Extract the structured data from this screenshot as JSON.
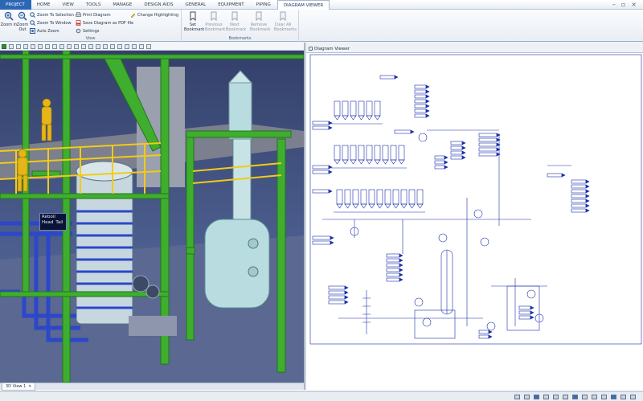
{
  "ribbon": {
    "tabs": [
      "PROJECT",
      "HOME",
      "VIEW",
      "TOOLS",
      "MANAGE",
      "DESIGN AIDS",
      "GENERAL",
      "EQUIPMENT",
      "PIPING",
      "DIAGRAM VIEWER"
    ],
    "active_tab": "DIAGRAM VIEWER",
    "view_group": {
      "zoom_in_label": "Zoom In",
      "zoom_out_label": "Zoom Out",
      "zoom_to_selection": "Zoom To Selection",
      "zoom_to_window": "Zoom To Window",
      "auto_zoom": "Auto Zoom",
      "print_diagram": "Print Diagram",
      "save_as_pdf": "Save Diagram as PDF file",
      "settings": "Settings",
      "change_highlighting": "Change Highlighting",
      "label": "View"
    },
    "bookmarks_group": {
      "set_bookmark": "Set Bookmark",
      "previous_bookmark": "Previous Bookmark",
      "next_bookmark": "Next Bookmark",
      "remove_bookmark": "Remove Bookmark",
      "clear_all_bookmarks": "Clear All Bookmarks",
      "label": "Bookmarks"
    }
  },
  "model_view": {
    "tag_label_1": "Reboil",
    "tag_label_2": "Head",
    "tag_label_3": "Tail",
    "tab_label": "3D View 1"
  },
  "diagram_viewer": {
    "title": "Diagram Viewer"
  },
  "colors": {
    "steel_green": "#3fae2f",
    "handrail_yellow": "#f2cb16",
    "pipe_blue": "#2c47c9",
    "vessel_cyan": "#b8dce0",
    "diagram_ink": "#1a2fa8",
    "accent": "#2c67b5"
  }
}
